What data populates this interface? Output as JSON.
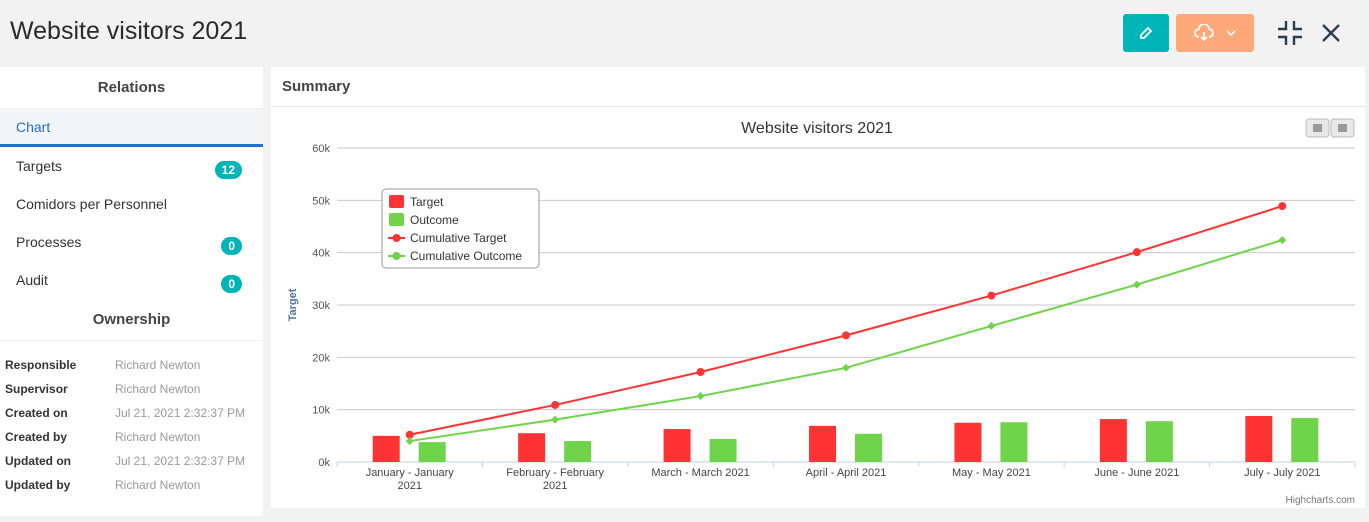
{
  "header": {
    "title": "Website visitors 2021",
    "edit_icon": "pencil-icon",
    "download_icon": "cloud-download-icon",
    "compress_icon": "compress-icon",
    "close_icon": "close-icon"
  },
  "sidebar": {
    "relations_title": "Relations",
    "items": [
      {
        "label": "Chart"
      },
      {
        "label": "Targets",
        "badge": "12"
      },
      {
        "label": "Comidors per Personnel"
      },
      {
        "label": "Processes",
        "badge": "0"
      },
      {
        "label": "Audit",
        "badge": "0"
      }
    ],
    "ownership_title": "Ownership",
    "ownership": [
      {
        "k": "Responsible",
        "v": "Richard Newton"
      },
      {
        "k": "Supervisor",
        "v": "Richard Newton"
      },
      {
        "k": "Created on",
        "v": "Jul 21, 2021 2:32:37 PM"
      },
      {
        "k": "Created by",
        "v": "Richard Newton"
      },
      {
        "k": "Updated on",
        "v": "Jul 21, 2021 2:32:37 PM"
      },
      {
        "k": "Updated by",
        "v": "Richard Newton"
      }
    ]
  },
  "main": {
    "title": "Summary",
    "credit": "Highcharts.com"
  },
  "chart_data": {
    "type": "bar",
    "title": "Website visitors 2021",
    "ylabel": "Target",
    "ylim": [
      0,
      60000
    ],
    "yticks": [
      "0k",
      "10k",
      "20k",
      "30k",
      "40k",
      "50k",
      "60k"
    ],
    "categories": [
      [
        "January - January",
        "2021"
      ],
      [
        "February - February",
        "2021"
      ],
      [
        "March - March 2021"
      ],
      [
        "April - April 2021"
      ],
      [
        "May - May 2021"
      ],
      [
        "June - June 2021"
      ],
      [
        "July - July 2021"
      ]
    ],
    "legend_position": "top-left",
    "grid": true,
    "series": [
      {
        "name": "Target",
        "type": "bar",
        "color": "#ff3333",
        "values": [
          5000,
          5500,
          6300,
          6900,
          7500,
          8200,
          8800
        ]
      },
      {
        "name": "Outcome",
        "type": "bar",
        "color": "#6fd44a",
        "values": [
          3800,
          4000,
          4400,
          5400,
          7600,
          7800,
          8400
        ]
      },
      {
        "name": "Cumulative Target",
        "type": "line",
        "color": "#ff3333",
        "values": [
          5200,
          10900,
          17200,
          24200,
          31800,
          40100,
          48900
        ]
      },
      {
        "name": "Cumulative Outcome",
        "type": "line",
        "color": "#6fd44a",
        "values": [
          4000,
          8100,
          12600,
          18000,
          26000,
          33900,
          42400
        ]
      }
    ]
  }
}
